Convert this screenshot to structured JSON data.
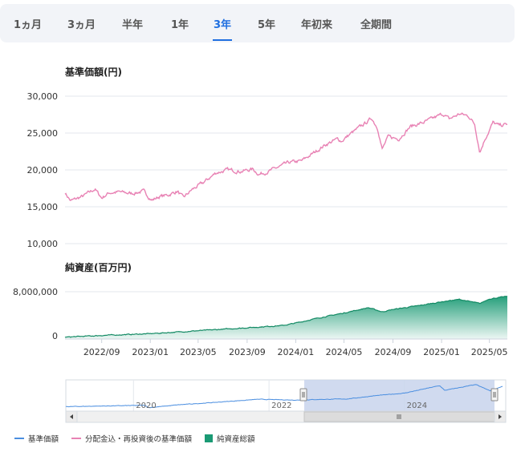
{
  "tabs": [
    {
      "label": "1ヵ月",
      "active": false
    },
    {
      "label": "3ヵ月",
      "active": false
    },
    {
      "label": "半年",
      "active": false
    },
    {
      "label": "1年",
      "active": false
    },
    {
      "label": "3年",
      "active": true
    },
    {
      "label": "5年",
      "active": false
    },
    {
      "label": "年初来",
      "active": false
    },
    {
      "label": "全期間",
      "active": false
    }
  ],
  "chart_data": [
    {
      "type": "line",
      "title": "基準価額(円)",
      "ylim": [
        10000,
        30000
      ],
      "yticks": [
        10000,
        15000,
        20000,
        25000,
        30000
      ],
      "ytick_labels": [
        "10,000",
        "15,000",
        "20,000",
        "25,000",
        "30,000"
      ],
      "series": [
        {
          "name": "分配金込・再投資後の基準価額",
          "color": "#e882b4",
          "x": [
            "2022-06-01",
            "2022-06-15",
            "2022-07-15",
            "2022-08-15",
            "2022-09-01",
            "2022-09-20",
            "2022-10-15",
            "2022-11-15",
            "2022-12-15",
            "2023-01-05",
            "2023-01-25",
            "2023-02-15",
            "2023-03-10",
            "2023-03-25",
            "2023-04-15",
            "2023-05-15",
            "2023-06-15",
            "2023-07-15",
            "2023-08-15",
            "2023-09-15",
            "2023-10-01",
            "2023-10-25",
            "2023-11-15",
            "2023-12-15",
            "2024-01-15",
            "2024-02-15",
            "2024-03-15",
            "2024-04-15",
            "2024-04-25",
            "2024-05-15",
            "2024-06-15",
            "2024-07-10",
            "2024-07-25",
            "2024-08-05",
            "2024-08-20",
            "2024-09-15",
            "2024-10-15",
            "2024-11-15",
            "2024-12-15",
            "2025-01-05",
            "2025-01-20",
            "2025-02-15",
            "2025-03-10",
            "2025-03-25",
            "2025-04-07",
            "2025-04-20",
            "2025-05-10",
            "2025-05-25",
            "2025-06-15"
          ],
          "values": [
            16900,
            15800,
            16400,
            17400,
            16200,
            16900,
            17000,
            16800,
            17100,
            15900,
            16400,
            16600,
            17100,
            16200,
            17300,
            18300,
            19600,
            20000,
            19800,
            20100,
            19400,
            19800,
            20300,
            21000,
            21200,
            22300,
            23400,
            24200,
            23900,
            24800,
            26000,
            27000,
            25600,
            22800,
            24500,
            24200,
            25900,
            26400,
            27100,
            27600,
            26900,
            27600,
            27300,
            26200,
            22400,
            24200,
            26400,
            26000,
            26200
          ]
        }
      ]
    },
    {
      "type": "area",
      "title": "純資産(百万円)",
      "ylim": [
        0,
        8000000
      ],
      "yticks": [
        0,
        8000000
      ],
      "ytick_labels": [
        "0",
        "8,000,000"
      ],
      "xtick_labels": [
        "2022/09",
        "2023/01",
        "2023/05",
        "2023/09",
        "2024/01",
        "2024/05",
        "2024/09",
        "2025/01",
        "2025/05"
      ],
      "series": [
        {
          "name": "純資産総額",
          "color": "#1a9a74",
          "x": [
            "2022-06-01",
            "2022-09-01",
            "2023-01-01",
            "2023-05-01",
            "2023-09-01",
            "2023-12-01",
            "2024-01-01",
            "2024-03-01",
            "2024-05-01",
            "2024-07-01",
            "2024-08-05",
            "2024-09-01",
            "2024-11-01",
            "2025-01-01",
            "2025-02-15",
            "2025-04-07",
            "2025-05-01",
            "2025-06-15"
          ],
          "values": [
            300000,
            600000,
            900000,
            1400000,
            1900000,
            2300000,
            2700000,
            3600000,
            4400000,
            5300000,
            4600000,
            5000000,
            5600000,
            6300000,
            6700000,
            6000000,
            6800000,
            7200000
          ]
        }
      ]
    },
    {
      "type": "navigator",
      "xtick_labels": [
        "2020",
        "2022",
        "2024"
      ]
    }
  ],
  "legend": [
    {
      "label": "基準価額",
      "color": "#4a8ee0",
      "kind": "line"
    },
    {
      "label": "分配金込・再投資後の基準価額",
      "color": "#e882b4",
      "kind": "line"
    },
    {
      "label": "純資産総額",
      "color": "#1a9a74",
      "kind": "box"
    }
  ]
}
